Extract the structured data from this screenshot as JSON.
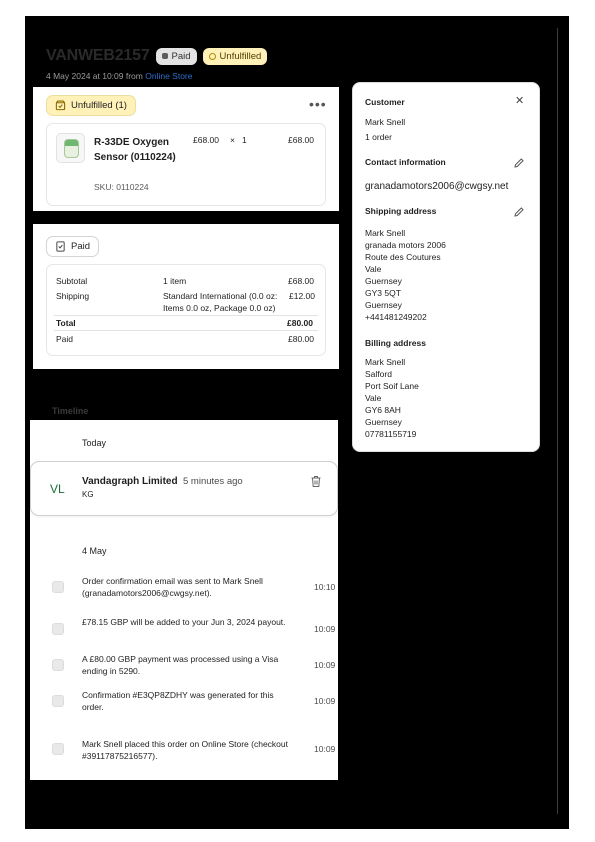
{
  "order": {
    "number": "VANWEB2157",
    "paid_badge": "Paid",
    "unfulfilled_badge": "Unfulfilled",
    "date_text": "4 May 2024 at 10:09 from ",
    "channel_link": "Online Store"
  },
  "fulfillment": {
    "status_label": "Unfulfilled (1)",
    "menu_icon": "more-horizontal-icon",
    "item": {
      "name": "R-33DE Oxygen Sensor (0110224)",
      "sku": "SKU: 0110224",
      "price": "£68.00",
      "times": "×",
      "qty": "1",
      "total": "£68.00"
    }
  },
  "payment": {
    "status_label": "Paid",
    "rows": {
      "subtotal_label": "Subtotal",
      "subtotal_desc": "1 item",
      "subtotal_value": "£68.00",
      "shipping_label": "Shipping",
      "shipping_desc_1": "Standard International (0.0 oz:",
      "shipping_desc_2": "Items 0.0 oz, Package 0.0 oz)",
      "shipping_value": "£12.00",
      "total_label": "Total",
      "total_value": "£80.00",
      "paid_label": "Paid",
      "paid_value": "£80.00"
    }
  },
  "customer": {
    "heading": "Customer",
    "name": "Mark Snell",
    "orders": "1 order",
    "contact_heading": "Contact information",
    "email": "granadamotors2006@cwgsy.net",
    "shipping_heading": "Shipping address",
    "shipping_lines": [
      "Mark Snell",
      "granada motors 2006",
      "Route des Coutures",
      "Vale",
      "Guernsey",
      "GY3 5QT",
      "Guernsey",
      "+441481249202"
    ],
    "billing_heading": "Billing address",
    "billing_lines": [
      "Mark Snell",
      "Salford",
      "Port Soif Lane",
      "Vale",
      "GY6 8AH",
      "Guernsey",
      "07781155719"
    ]
  },
  "timeline": {
    "title": "Timeline",
    "today_label": "Today",
    "comment": {
      "initials": "VL",
      "author": "Vandagraph Limited",
      "ago": "5 minutes ago",
      "body": "KG"
    },
    "date_label": "4 May",
    "events": [
      {
        "text": "Order confirmation email was sent to Mark Snell (granadamotors2006@cwgsy.net).",
        "time": "10:10"
      },
      {
        "text": "£78.15 GBP will be added to your Jun 3, 2024 payout.",
        "time": "10:09"
      },
      {
        "text": "A £80.00 GBP payment was processed using a Visa ending in 5290.",
        "time": "10:09"
      },
      {
        "text": "Confirmation #E3QP8ZDHY was generated for this order.",
        "time": "10:09"
      },
      {
        "text": "Mark Snell placed this order on Online Store (checkout #39117875216577).",
        "time": "10:09"
      }
    ]
  },
  "colors": {
    "unfulfilled_bg": "#fff1b8",
    "link": "#2c6ecb",
    "initials_green": "#1e6b3a"
  }
}
